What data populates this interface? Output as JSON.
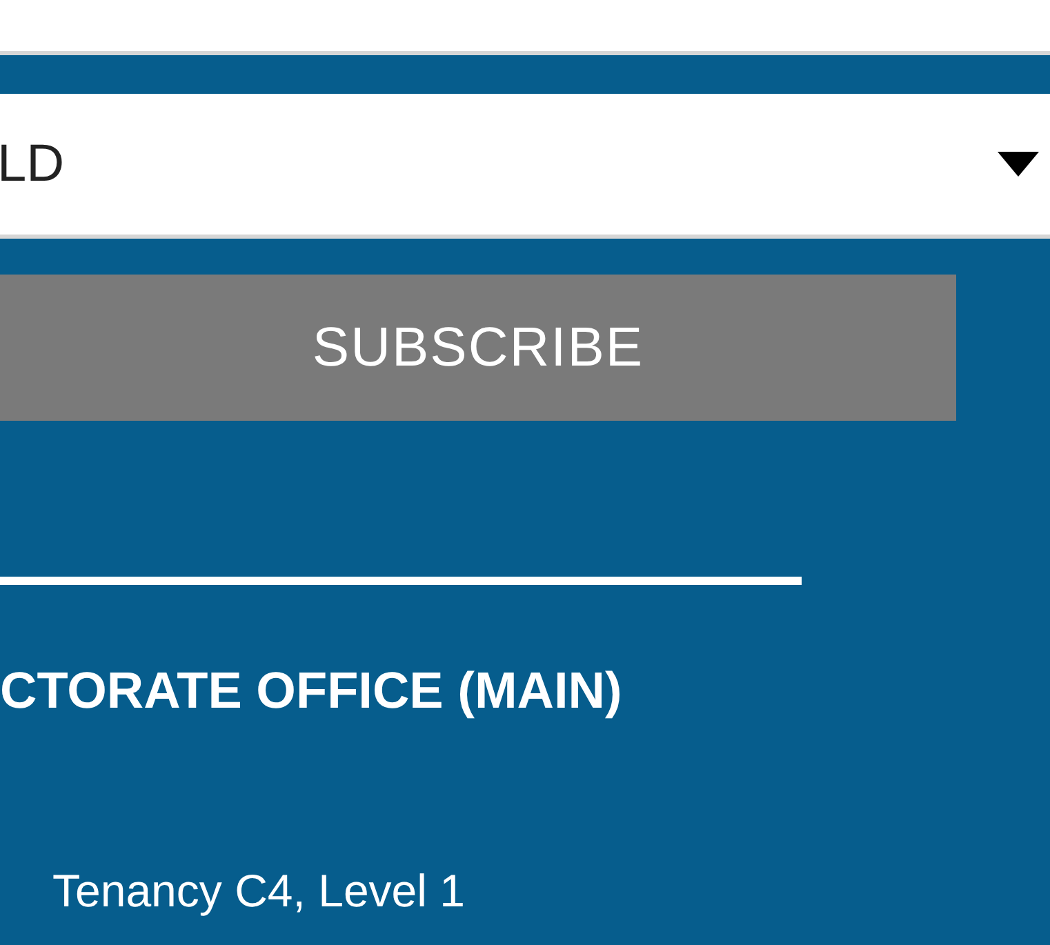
{
  "state_select": {
    "value": "LD"
  },
  "subscribe_button": {
    "label": "SUBSCRIBE"
  },
  "office": {
    "title": "CTORATE OFFICE (MAIN)",
    "address_line": "Tenancy C4, Level 1"
  }
}
